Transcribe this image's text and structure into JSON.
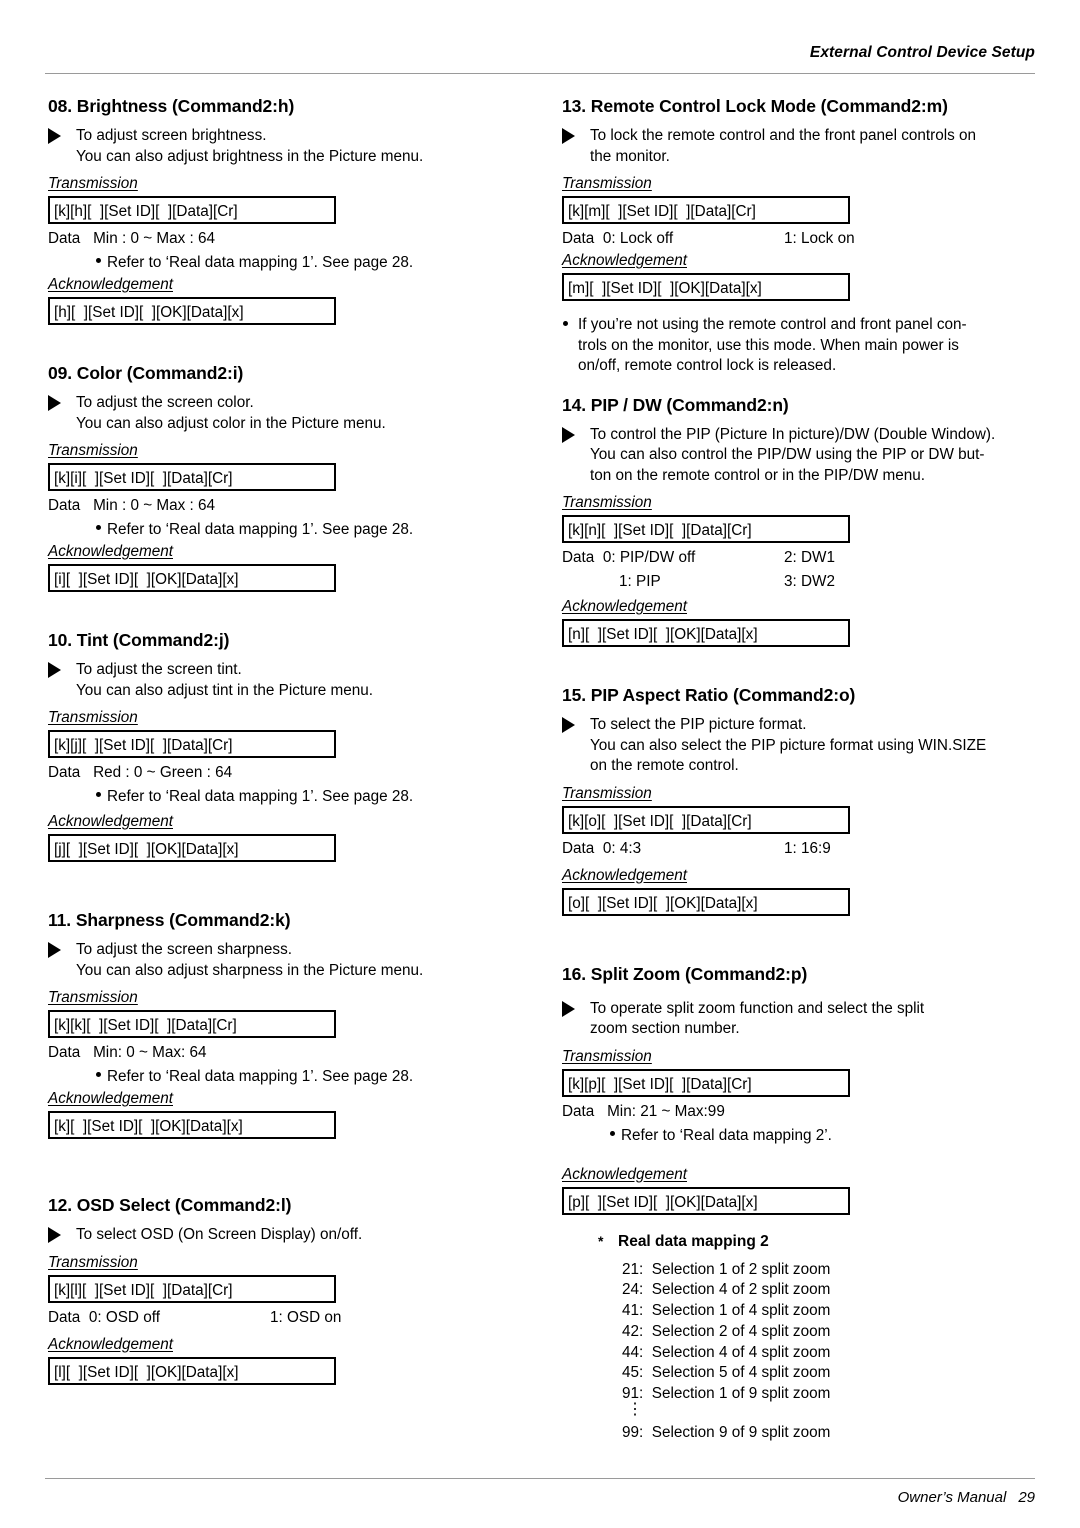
{
  "header": {
    "running_title": "External Control Device Setup"
  },
  "footer": {
    "manual_label": "Owner’s Manual",
    "page_number": "29"
  },
  "labels": {
    "transmission": "Transmission",
    "acknowledgement": "Acknowledgement",
    "data": "Data"
  },
  "sections": {
    "s08": {
      "title": "08. Brightness (Command2:h)",
      "desc_line1": "To adjust screen brightness.",
      "desc_line2": "You can also adjust brightness in the Picture menu.",
      "transmission_label": "Transmission",
      "transmission_box": "[k][h][  ][Set ID][  ][Data][Cr]",
      "data_label": "Data",
      "data_value": "Min : 0 ~ Max : 64",
      "ref_note": "Refer to ‘Real data mapping 1’. See page 28.",
      "ack_label": "Acknowledgement",
      "ack_box": "[h][  ][Set ID][  ][OK][Data][x]"
    },
    "s09": {
      "title": "09. Color (Command2:i)",
      "desc_line1": "To adjust the screen color.",
      "desc_line2": "You can also adjust color in the Picture menu.",
      "transmission_label": "Transmission",
      "transmission_box": "[k][i][  ][Set ID][  ][Data][Cr]",
      "data_label": "Data",
      "data_value": "Min : 0 ~ Max : 64",
      "ref_note": "Refer to ‘Real data mapping 1’. See page 28.",
      "ack_label": "Acknowledgement",
      "ack_box": "[i][  ][Set ID][  ][OK][Data][x]"
    },
    "s10": {
      "title": "10. Tint (Command2:j)",
      "desc_line1": "To adjust the screen tint.",
      "desc_line2": "You can also adjust tint in the Picture menu.",
      "transmission_label": "Transmission",
      "transmission_box": "[k][j][  ][Set ID][  ][Data][Cr]",
      "data_label": "Data",
      "data_value": "Red : 0 ~ Green : 64",
      "ref_note": "Refer to ‘Real data mapping 1’. See page 28.",
      "ack_label": "Acknowledgement",
      "ack_box": "[j][  ][Set ID][  ][OK][Data][x]"
    },
    "s11": {
      "title": "11. Sharpness (Command2:k)",
      "desc_line1": "To adjust the screen sharpness.",
      "desc_line2": "You can also adjust sharpness in the Picture menu.",
      "transmission_label": "Transmission",
      "transmission_box": "[k][k][  ][Set ID][  ][Data][Cr]",
      "data_label": "Data",
      "data_value": "Min: 0 ~ Max: 64",
      "ref_note": "Refer to ‘Real data mapping 1’. See page 28.",
      "ack_label": "Acknowledgement",
      "ack_box": "[k][  ][Set ID][  ][OK][Data][x]"
    },
    "s12": {
      "title": "12. OSD Select (Command2:l)",
      "desc_line1": "To select OSD (On Screen Display) on/off.",
      "transmission_label": "Transmission",
      "transmission_box": "[k][l][  ][Set ID][  ][Data][Cr]",
      "data_label": "Data",
      "data_value_1": "0: OSD off",
      "data_value_2": "1: OSD on",
      "ack_label": "Acknowledgement",
      "ack_box": "[l][  ][Set ID][  ][OK][Data][x]"
    },
    "s13": {
      "title": "13. Remote Control Lock Mode (Command2:m)",
      "desc_line1": "To lock the remote control and the front panel controls on",
      "desc_line2": "the monitor.",
      "transmission_label": "Transmission",
      "transmission_box": "[k][m][  ][Set ID][  ][Data][Cr]",
      "data_label": "Data",
      "data_value_1": "0: Lock off",
      "data_value_2": "1: Lock on",
      "ack_label": "Acknowledgement",
      "ack_box": "[m][  ][Set ID][  ][OK][Data][x]",
      "note_line1": "If you’re not using the remote control and front panel con-",
      "note_line2": "trols on the monitor, use this mode. When main power is",
      "note_line3": "on/off, remote control lock is released."
    },
    "s14": {
      "title": "14. PIP / DW (Command2:n)",
      "desc_line1": "To control the PIP (Picture In picture)/DW (Double Window).",
      "desc_line2": "You can also control the PIP/DW using the PIP or DW but-",
      "desc_line3": "ton on the remote control or in the PIP/DW menu.",
      "transmission_label": "Transmission",
      "transmission_box": "[k][n][  ][Set ID][  ][Data][Cr]",
      "data_label": "Data",
      "data_value_1": "0: PIP/DW off",
      "data_value_2": "2: DW1",
      "data_value_3": "1: PIP",
      "data_value_4": "3: DW2",
      "ack_label": "Acknowledgement",
      "ack_box": "[n][  ][Set ID][  ][OK][Data][x]"
    },
    "s15": {
      "title": "15. PIP Aspect Ratio (Command2:o)",
      "desc_line1": "To select the PIP picture format.",
      "desc_line2": "You can also select the PIP picture format using WIN.SIZE",
      "desc_line3": "on the remote control.",
      "transmission_label": "Transmission",
      "transmission_box": "[k][o][  ][Set ID][  ][Data][Cr]",
      "data_label": "Data",
      "data_value_1": "0: 4:3",
      "data_value_2": "1: 16:9",
      "ack_label": "Acknowledgement",
      "ack_box": "[o][  ][Set ID][  ][OK][Data][x]"
    },
    "s16": {
      "title": "16. Split Zoom (Command2:p)",
      "desc_line1": "To operate split zoom function and select the split",
      "desc_line2": "zoom section number.",
      "transmission_label": "Transmission",
      "transmission_box": "[k][p][  ][Set ID][  ][Data][Cr]",
      "data_label": "Data",
      "data_value": "Min: 21 ~ Max:99",
      "ref_note": "Refer to ‘Real data mapping 2’.",
      "ack_label": "Acknowledgement",
      "ack_box": "[p][  ][Set ID][  ][OK][Data][x]"
    }
  },
  "real_data_mapping_2": {
    "star": "*",
    "title": "Real data mapping 2",
    "rows": [
      "21:  Selection 1 of 2 split zoom",
      "24:  Selection 4 of 2 split zoom",
      "41:  Selection 1 of 4 split zoom",
      "42:  Selection 2 of 4 split zoom",
      "44:  Selection 4 of 4 split zoom",
      "45:  Selection 5 of 4 split zoom",
      "91:  Selection 1 of 9 split zoom"
    ],
    "ellipsis": "⋮",
    "last_row": "99:  Selection 9 of 9 split zoom"
  }
}
